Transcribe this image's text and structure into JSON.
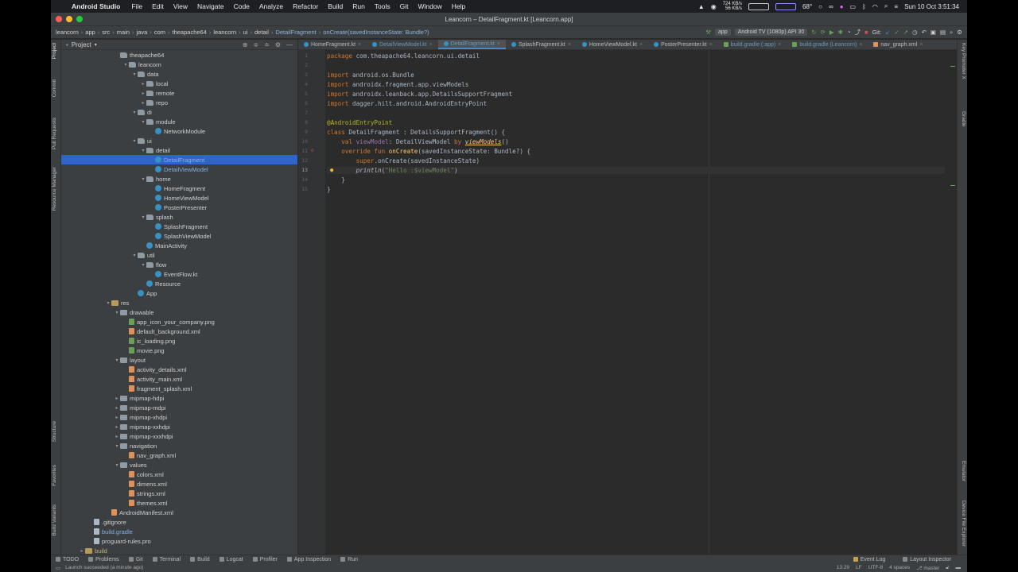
{
  "menubar": {
    "app_name": "Android Studio",
    "menus": [
      "File",
      "Edit",
      "View",
      "Navigate",
      "Code",
      "Analyze",
      "Refactor",
      "Build",
      "Run",
      "Tools",
      "Git",
      "Window",
      "Help"
    ],
    "net_up": "724 KB/s",
    "net_down": "56 KB/s",
    "temperature": "68°",
    "clock": "Sun 10 Oct  3:51:34"
  },
  "window": {
    "title": "Leancorn – DetailFragment.kt [Leancorn.app]"
  },
  "breadcrumb": {
    "items": [
      "leancorn",
      "app",
      "src",
      "main",
      "java",
      "com",
      "theapache64",
      "leancorn",
      "ui",
      "detail",
      "DetailFragment",
      "onCreate(savedInstanceState: Bundle?)"
    ]
  },
  "toolbar": {
    "run_config": "app",
    "device": "Android TV (1080p) API 30",
    "git_label": "Git:"
  },
  "project_panel": {
    "title": "Project",
    "tree": [
      {
        "label": "theapache64",
        "indent": 6,
        "icon": "pkg",
        "arrow": ""
      },
      {
        "label": "leancorn",
        "indent": 7,
        "icon": "pkg",
        "arrow": "▾"
      },
      {
        "label": "data",
        "indent": 8,
        "icon": "pkg",
        "arrow": "▾"
      },
      {
        "label": "local",
        "indent": 9,
        "icon": "pkg",
        "arrow": "▸"
      },
      {
        "label": "remote",
        "indent": 9,
        "icon": "pkg",
        "arrow": "▸"
      },
      {
        "label": "repo",
        "indent": 9,
        "icon": "pkg",
        "arrow": "▸"
      },
      {
        "label": "di",
        "indent": 8,
        "icon": "pkg",
        "arrow": "▾"
      },
      {
        "label": "module",
        "indent": 9,
        "icon": "pkg",
        "arrow": "▾"
      },
      {
        "label": "NetworkModule",
        "indent": 10,
        "icon": "kt",
        "arrow": ""
      },
      {
        "label": "ui",
        "indent": 8,
        "icon": "pkg",
        "arrow": "▾"
      },
      {
        "label": "detail",
        "indent": 9,
        "icon": "pkg",
        "arrow": "▾"
      },
      {
        "label": "DetailFragment",
        "indent": 10,
        "icon": "kt",
        "arrow": "",
        "selected": true,
        "color": "blue"
      },
      {
        "label": "DetailViewModel",
        "indent": 10,
        "icon": "kt",
        "arrow": "",
        "color": "blue"
      },
      {
        "label": "home",
        "indent": 9,
        "icon": "pkg",
        "arrow": "▾"
      },
      {
        "label": "HomeFragment",
        "indent": 10,
        "icon": "kt",
        "arrow": ""
      },
      {
        "label": "HomeViewModel",
        "indent": 10,
        "icon": "kt",
        "arrow": ""
      },
      {
        "label": "PosterPresenter",
        "indent": 10,
        "icon": "kt",
        "arrow": ""
      },
      {
        "label": "splash",
        "indent": 9,
        "icon": "pkg",
        "arrow": "▾"
      },
      {
        "label": "SplashFragment",
        "indent": 10,
        "icon": "kt",
        "arrow": ""
      },
      {
        "label": "SplashViewModel",
        "indent": 10,
        "icon": "kt",
        "arrow": ""
      },
      {
        "label": "MainActivity",
        "indent": 9,
        "icon": "kt",
        "arrow": ""
      },
      {
        "label": "util",
        "indent": 8,
        "icon": "pkg",
        "arrow": "▾"
      },
      {
        "label": "flow",
        "indent": 9,
        "icon": "pkg",
        "arrow": "▾"
      },
      {
        "label": "EventFlow.kt",
        "indent": 10,
        "icon": "kt",
        "arrow": ""
      },
      {
        "label": "Resource",
        "indent": 9,
        "icon": "kt",
        "arrow": ""
      },
      {
        "label": "App",
        "indent": 8,
        "icon": "kt",
        "arrow": ""
      },
      {
        "label": "res",
        "indent": 5,
        "icon": "res",
        "arrow": "▾"
      },
      {
        "label": "drawable",
        "indent": 6,
        "icon": "folder",
        "arrow": "▾"
      },
      {
        "label": "app_icon_your_company.png",
        "indent": 7,
        "icon": "img",
        "arrow": ""
      },
      {
        "label": "default_background.xml",
        "indent": 7,
        "icon": "xml",
        "arrow": ""
      },
      {
        "label": "ic_loading.png",
        "indent": 7,
        "icon": "img",
        "arrow": ""
      },
      {
        "label": "movie.png",
        "indent": 7,
        "icon": "img",
        "arrow": ""
      },
      {
        "label": "layout",
        "indent": 6,
        "icon": "folder",
        "arrow": "▾"
      },
      {
        "label": "activity_details.xml",
        "indent": 7,
        "icon": "xml",
        "arrow": ""
      },
      {
        "label": "activity_main.xml",
        "indent": 7,
        "icon": "xml",
        "arrow": ""
      },
      {
        "label": "fragment_splash.xml",
        "indent": 7,
        "icon": "xml",
        "arrow": ""
      },
      {
        "label": "mipmap-hdpi",
        "indent": 6,
        "icon": "folder",
        "arrow": "▸"
      },
      {
        "label": "mipmap-mdpi",
        "indent": 6,
        "icon": "folder",
        "arrow": "▸"
      },
      {
        "label": "mipmap-xhdpi",
        "indent": 6,
        "icon": "folder",
        "arrow": "▸"
      },
      {
        "label": "mipmap-xxhdpi",
        "indent": 6,
        "icon": "folder",
        "arrow": "▸"
      },
      {
        "label": "mipmap-xxxhdpi",
        "indent": 6,
        "icon": "folder",
        "arrow": "▸"
      },
      {
        "label": "navigation",
        "indent": 6,
        "icon": "folder",
        "arrow": "▾"
      },
      {
        "label": "nav_graph.xml",
        "indent": 7,
        "icon": "xml",
        "arrow": ""
      },
      {
        "label": "values",
        "indent": 6,
        "icon": "folder",
        "arrow": "▾"
      },
      {
        "label": "colors.xml",
        "indent": 7,
        "icon": "xml",
        "arrow": ""
      },
      {
        "label": "dimens.xml",
        "indent": 7,
        "icon": "xml",
        "arrow": ""
      },
      {
        "label": "strings.xml",
        "indent": 7,
        "icon": "xml",
        "arrow": ""
      },
      {
        "label": "themes.xml",
        "indent": 7,
        "icon": "xml",
        "arrow": ""
      },
      {
        "label": "AndroidManifest.xml",
        "indent": 5,
        "icon": "xml",
        "arrow": ""
      },
      {
        "label": ".gitignore",
        "indent": 3,
        "icon": "file",
        "arrow": ""
      },
      {
        "label": "build.gradle",
        "indent": 3,
        "icon": "file",
        "arrow": "",
        "color": "blue"
      },
      {
        "label": "proguard-rules.pro",
        "indent": 3,
        "icon": "file",
        "arrow": ""
      },
      {
        "label": "build",
        "indent": 2,
        "icon": "res",
        "arrow": "▸",
        "color": "yellow"
      }
    ]
  },
  "left_tool_tabs": [
    "Project",
    "Commit",
    "Pull Requests",
    "Resource Manager",
    "Structure",
    "Favorites",
    "Build Variants"
  ],
  "right_tool_tabs": [
    "Key Promoter X",
    "Gradle",
    "Emulator",
    "Device File Explorer"
  ],
  "editor_tabs": [
    {
      "label": "HomeFragment.kt",
      "icon": "kt"
    },
    {
      "label": "DetailViewModel.kt",
      "icon": "kt",
      "modified": true
    },
    {
      "label": "DetailFragment.kt",
      "icon": "kt",
      "active": true,
      "modified": true
    },
    {
      "label": "SplashFragment.kt",
      "icon": "kt"
    },
    {
      "label": "HomeViewModel.kt",
      "icon": "kt"
    },
    {
      "label": "PosterPresenter.kt",
      "icon": "kt"
    },
    {
      "label": "build.gradle (:app)",
      "icon": "g",
      "modified": true
    },
    {
      "label": "build.gradle (Leancorn)",
      "icon": "g",
      "modified": true
    },
    {
      "label": "nav_graph.xml",
      "icon": "x"
    }
  ],
  "code": {
    "current_line": 13,
    "lines": [
      [
        {
          "t": "package",
          "c": "kw"
        },
        {
          "t": " com.theapache64.leancorn.ui.detail"
        }
      ],
      [],
      [
        {
          "t": "import",
          "c": "kw"
        },
        {
          "t": " android.os.Bundle"
        }
      ],
      [
        {
          "t": "import",
          "c": "kw"
        },
        {
          "t": " androidx.fragment.app.viewModels"
        }
      ],
      [
        {
          "t": "import",
          "c": "kw"
        },
        {
          "t": " androidx.leanback.app.DetailsSupportFragment"
        }
      ],
      [
        {
          "t": "import",
          "c": "kw"
        },
        {
          "t": " dagger.hilt.android.AndroidEntryPoint"
        }
      ],
      [],
      [
        {
          "t": "@AndroidEntryPoint",
          "c": "ann"
        }
      ],
      [
        {
          "t": "class",
          "c": "kw"
        },
        {
          "t": " DetailFragment : DetailsSupportFragment() {"
        }
      ],
      [
        {
          "t": "    val",
          "c": "kw"
        },
        {
          "t": " "
        },
        {
          "t": "viewModel",
          "c": "prop"
        },
        {
          "t": ": DetailViewModel "
        },
        {
          "t": "by",
          "c": "kw"
        },
        {
          "t": " "
        },
        {
          "t": "viewModels",
          "c": "undl"
        },
        {
          "t": "()"
        }
      ],
      [
        {
          "t": "    override fun",
          "c": "kw"
        },
        {
          "t": " "
        },
        {
          "t": "onCreate",
          "c": "fn"
        },
        {
          "t": "(savedInstanceState: Bundle?) {"
        }
      ],
      [
        {
          "t": "        super",
          "c": "kw"
        },
        {
          "t": ".onCreate(savedInstanceState)"
        }
      ],
      [
        {
          "t": "        "
        },
        {
          "t": "println",
          "c": "ital"
        },
        {
          "t": "("
        },
        {
          "t": "\"Hello :$viewModel\"",
          "c": "str"
        },
        {
          "t": ")"
        }
      ],
      [
        {
          "t": "    }"
        }
      ],
      [
        {
          "t": "}"
        }
      ]
    ]
  },
  "bottom_tools": [
    "TODO",
    "Problems",
    "Git",
    "Terminal",
    "Build",
    "Logcat",
    "Profiler",
    "App Inspection",
    "Run"
  ],
  "bottom_tools_right": [
    "Event Log",
    "Layout Inspector"
  ],
  "status": {
    "message": "Launch succeeded (a minute ago)",
    "position": "13:29",
    "line_sep": "LF",
    "encoding": "UTF-8",
    "indent": "4 spaces",
    "branch": "master"
  }
}
